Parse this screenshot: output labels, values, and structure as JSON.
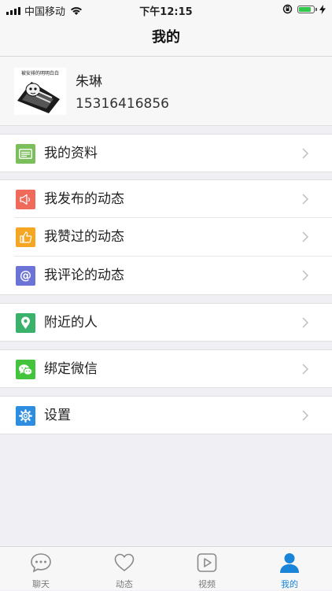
{
  "status_bar": {
    "carrier": "中国移动",
    "time": "下午12:15",
    "battery_level": 0.85
  },
  "nav": {
    "title": "我的"
  },
  "profile": {
    "name": "朱琳",
    "phone": "15316416856",
    "avatar_caption": "被安排的明明白白"
  },
  "menu": {
    "my_info": {
      "label": "我的资料",
      "icon": "id-card-icon",
      "color": "#7bbf5c"
    },
    "my_posts": {
      "label": "我发布的动态",
      "icon": "megaphone-icon",
      "color": "#ef6a5b"
    },
    "my_likes": {
      "label": "我赞过的动态",
      "icon": "thumbs-up-icon",
      "color": "#f5a623"
    },
    "my_comments": {
      "label": "我评论的动态",
      "icon": "at-sign-icon",
      "color": "#6b74d6"
    },
    "nearby": {
      "label": "附近的人",
      "icon": "location-pin-icon",
      "color": "#3bb26b"
    },
    "wechat": {
      "label": "绑定微信",
      "icon": "wechat-icon",
      "color": "#44c43c"
    },
    "settings": {
      "label": "设置",
      "icon": "gear-icon",
      "color": "#2d8de0"
    }
  },
  "tabs": [
    {
      "label": "聊天",
      "icon": "chat-bubble-icon",
      "active": false
    },
    {
      "label": "动态",
      "icon": "heart-icon",
      "active": false
    },
    {
      "label": "视频",
      "icon": "play-icon",
      "active": false
    },
    {
      "label": "我的",
      "icon": "person-icon",
      "active": true
    }
  ],
  "colors": {
    "accent": "#1a84d8",
    "background": "#efeff4"
  }
}
